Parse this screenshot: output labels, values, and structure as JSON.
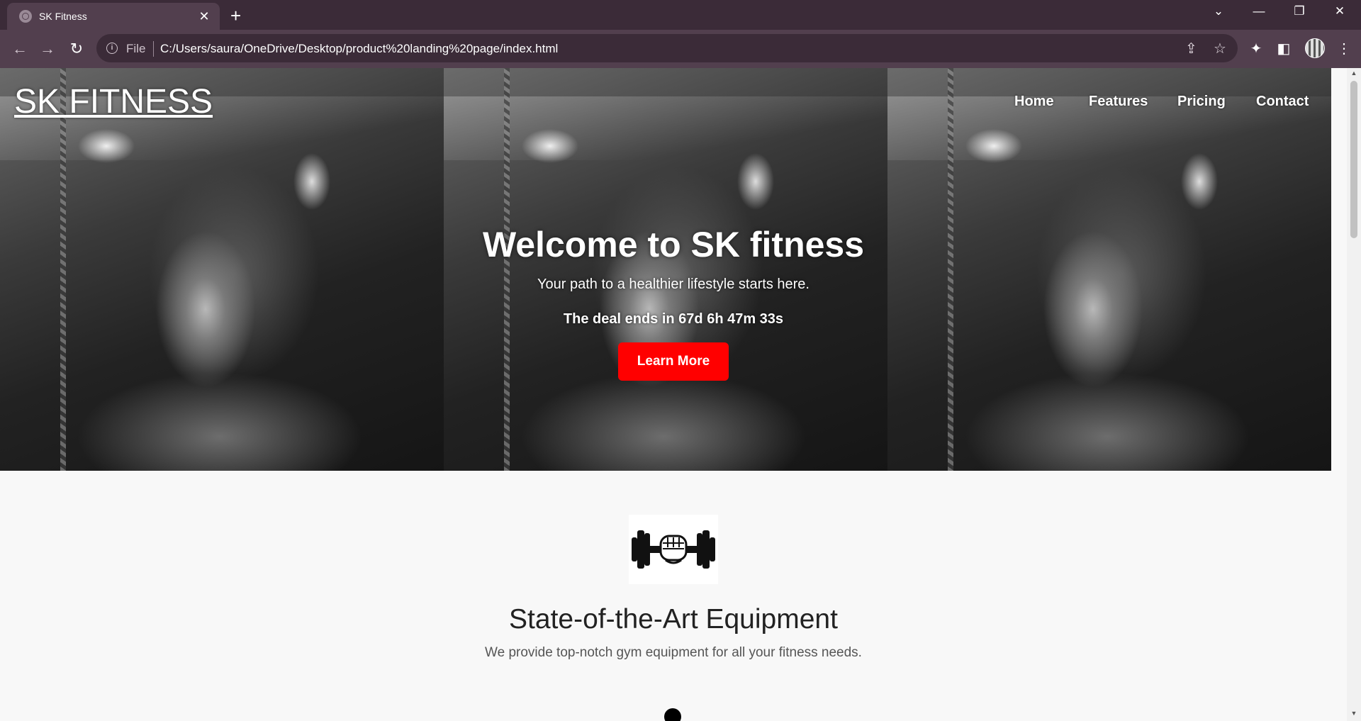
{
  "browser": {
    "tab_title": "SK Fitness",
    "tab_close": "✕",
    "new_tab": "+",
    "window_controls": [
      "⌄",
      "—",
      "❐",
      "✕"
    ],
    "nav_buttons": [
      "←",
      "→",
      "↻"
    ],
    "omnibox": {
      "scheme_label": "File",
      "url": "C:/Users/saura/OneDrive/Desktop/product%20landing%20page/index.html"
    },
    "toolbar_icons": [
      "share-icon",
      "star-icon",
      "extensions-icon",
      "sidepanel-icon",
      "profile-avatar",
      "menu-icon"
    ]
  },
  "page": {
    "brand": "SK FITNESS",
    "nav": [
      "Home",
      "Features",
      "Pricing",
      "Contact"
    ],
    "hero": {
      "title": "Welcome to SK fitness",
      "subtitle": "Your path to a healthier lifestyle starts here.",
      "deal": "The deal ends in 67d 6h 47m 33s",
      "cta": "Learn More"
    },
    "feature": {
      "icon": "dumbbell-fist-icon",
      "title": "State-of-the-Art Equipment",
      "description": "We provide top-notch gym equipment for all your fitness needs."
    }
  },
  "colors": {
    "chrome_dark": "#3b2b38",
    "chrome_toolbar": "#523f4e",
    "cta_red": "#ff0000",
    "page_bg": "#f8f8f8"
  }
}
